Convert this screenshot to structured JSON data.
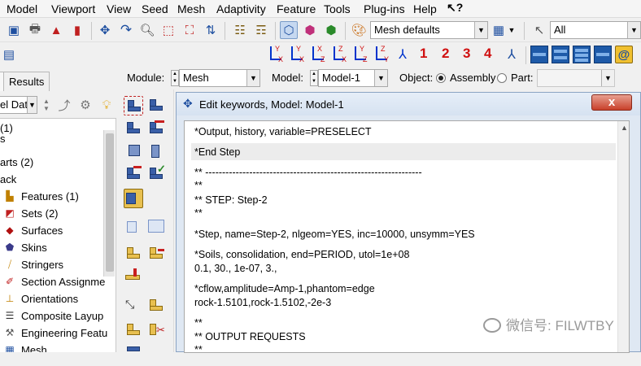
{
  "menubar": {
    "items": [
      "Model",
      "Viewport",
      "View",
      "Seed",
      "Mesh",
      "Adaptivity",
      "Feature",
      "Tools",
      "Plug-ins",
      "Help"
    ],
    "help_icon": "whats-this-arrow-icon"
  },
  "toolbar": {
    "render_style_value": "Mesh defaults",
    "selection_filter_value": "All",
    "view_numbers": [
      "1",
      "2",
      "3",
      "4"
    ]
  },
  "context": {
    "module_label": "Module:",
    "module_value": "Mesh",
    "model_label": "Model:",
    "model_value": "Model-1",
    "object_label": "Object:",
    "assembly_label": "Assembly",
    "part_label": "Part:",
    "object_selected": "Assembly"
  },
  "left_panel": {
    "tab_visible": "Results",
    "filter_value": "el Dat",
    "tree_items": [
      {
        "label": "(1)",
        "icon": "none"
      },
      {
        "label": "s",
        "icon": "none"
      },
      {
        "label": "arts (2)",
        "icon": "none"
      },
      {
        "label": "ack",
        "icon": "none"
      },
      {
        "label": "Features (1)",
        "icon": "features-icon"
      },
      {
        "label": "Sets (2)",
        "icon": "sets-icon"
      },
      {
        "label": "Surfaces",
        "icon": "surfaces-icon"
      },
      {
        "label": "Skins",
        "icon": "skins-icon"
      },
      {
        "label": "Stringers",
        "icon": "stringers-icon"
      },
      {
        "label": "Section Assignme",
        "icon": "section-assignment-icon"
      },
      {
        "label": "Orientations",
        "icon": "orientations-icon"
      },
      {
        "label": "Composite Layup",
        "icon": "composite-layup-icon"
      },
      {
        "label": "Engineering Featu",
        "icon": "engineering-features-icon"
      },
      {
        "label": "Mesh",
        "icon": "mesh-icon"
      }
    ]
  },
  "dialog": {
    "title": "Edit keywords, Model: Model-1",
    "close_label": "x",
    "lines": [
      "*Output, history, variable=PRESELECT",
      "*End Step",
      "** ----------------------------------------------------------------",
      "**",
      "** STEP: Step-2",
      "**",
      "*Step, name=Step-2, nlgeom=YES, inc=10000, unsymm=YES",
      "*Soils, consolidation, end=PERIOD, utol=1e+08",
      "0.1, 30., 1e-07, 3.,",
      "*cflow,amplitude=Amp-1,phantom=edge",
      "rock-1.5101,rock-1.5102,-2e-3",
      "**",
      "** OUTPUT REQUESTS",
      "**"
    ]
  },
  "watermark": "微信号: FILWTBY",
  "colors": {
    "accent_blue": "#1e5aa8",
    "red_numbers": "#d01010",
    "dialog_bg": "#dfe8f3"
  }
}
